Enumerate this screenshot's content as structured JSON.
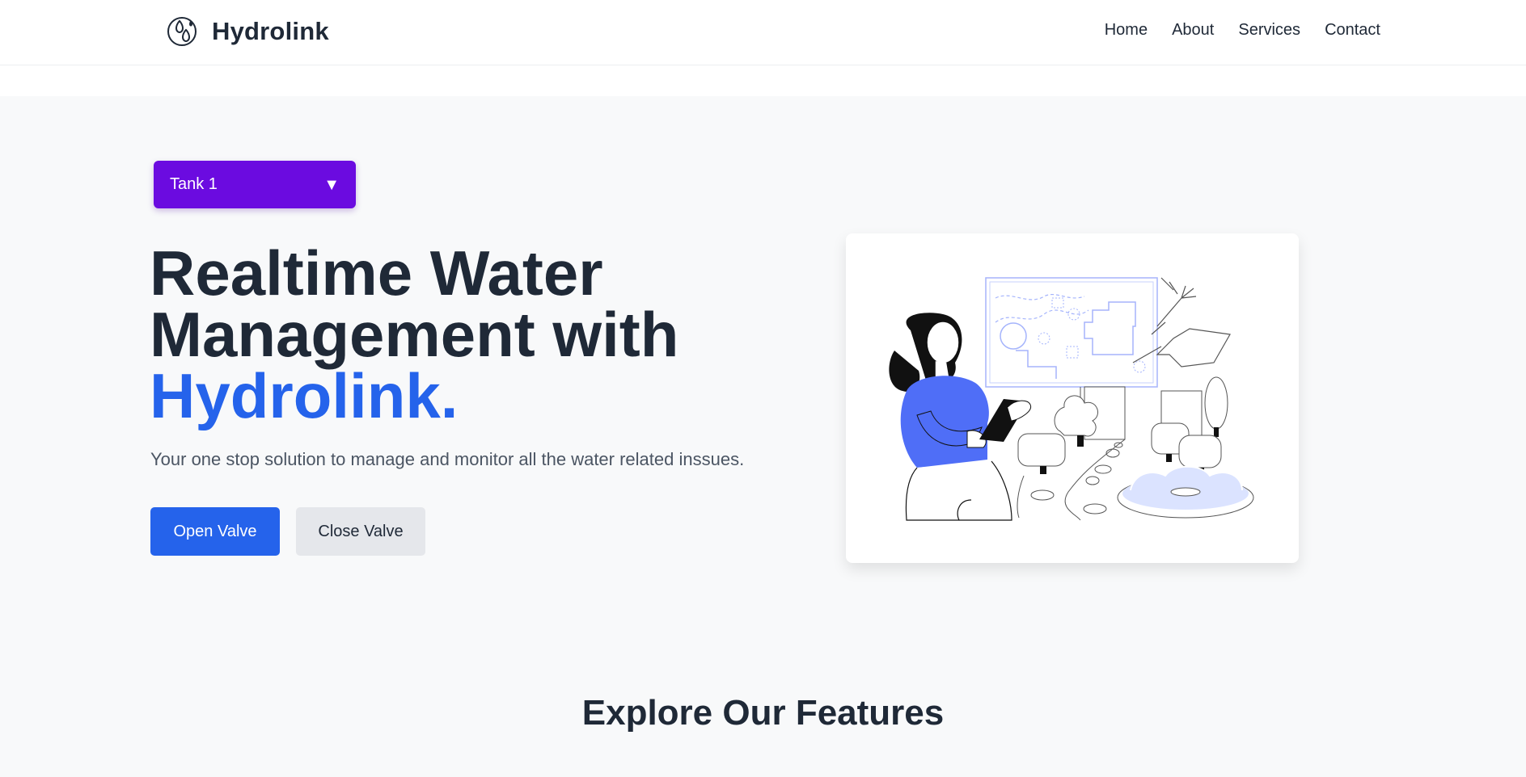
{
  "brand": {
    "name": "Hydrolink",
    "logo_icon": "water-drops-icon"
  },
  "nav": {
    "items": [
      {
        "label": "Home"
      },
      {
        "label": "About"
      },
      {
        "label": "Services"
      },
      {
        "label": "Contact"
      }
    ]
  },
  "tank_select": {
    "value": "Tank 1",
    "caret_icon": "caret-down-icon",
    "color": "#6b0be0"
  },
  "hero": {
    "title_line1": "Realtime Water",
    "title_line2": "Management with",
    "title_highlight": "Hydrolink.",
    "subtitle": "Your one stop solution to manage and monitor all the water related inssues.",
    "open_label": "Open Valve",
    "close_label": "Close Valve",
    "accent_color": "#2563eb"
  },
  "features": {
    "title": "Explore Our Features"
  }
}
